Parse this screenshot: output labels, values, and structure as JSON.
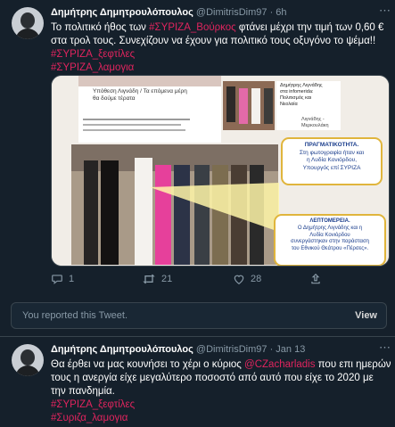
{
  "tweet1": {
    "name": "Δημήτρης Δημητρουλόπουλος",
    "handle": "@DimitrisDim97 · 6h",
    "text_a": "Το πολιτικό ήθος των ",
    "tag_a": "#ΣΥΡΙΖΑ_Βούρκος",
    "text_b": " φτάνει μέχρι την τιμή των 0,60 €",
    "text_c": "στα τρολ τους. Συνεχίζουν να έχουν για πολιτικό τους οξυγόνο το ψέμα!!",
    "tag_b": "#ΣΥΡΙΖΑ_ξεφτίλες",
    "tag_c": "#ΣΥΡΙΖΑ_λαμογια",
    "media": {
      "headline": "Υπόθεση Λιγνάδη / Τα επόμενα μέρη\nθα δούμε τέρατα",
      "top_right_title": "Δημήτρης Λιγνάδης\nστα infomerida:\nΠολιτισμός και\nΝεολαία",
      "top_right_caption": "Λιγνάδης -\nΜερκουλάκη",
      "box1_title": "ΠΡΑΓΜΑΤΙΚΟΤΗΤΑ.",
      "box1_text": "Στη φωτογραφία ήταν και\nη Λυδία Κονιόρδου,\nΥπουργός επί ΣΥΡΙΖΑ",
      "box2_title": "ΛΕΠΤΟΜΕΡΕΙΑ.",
      "box2_text": "Ο Δημήτρης Λιγνάδης και η\nΛυδία Κονιόρδου\nσυνεργάστηκαν στην παράσταση\nτου Εθνικού Θεάτρου «Πέρσες»."
    },
    "replies": "1",
    "retweets": "21",
    "likes": "28"
  },
  "reported": {
    "message": "You reported this Tweet.",
    "view": "View"
  },
  "tweet2": {
    "name": "Δημήτρης Δημητρουλόπουλος",
    "handle": "@DimitrisDim97 · Jan 13",
    "text_a": "Θα έρθει να μας κουνήσει το χέρι ο κύριος ",
    "mention": "@CZacharladis",
    "text_b": " που επι ημερών",
    "text_c": "τους η ανεργία είχε μεγαλύτερο ποσοστό από αυτό που είχε το 2020 με",
    "text_d": "την πανδημία.",
    "tag_a": "#ΣΥΡΙΖΑ_ξεφτίλες",
    "tag_b": "#Συριζα_λαμογια"
  },
  "colors": {
    "background": "#15202b",
    "hashtag": "#e0245e",
    "mention": "#1da1f2",
    "muted": "#8899a6",
    "border": "#38444d"
  }
}
